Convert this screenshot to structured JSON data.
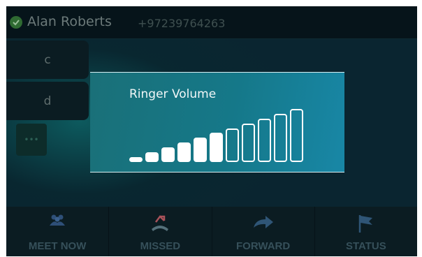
{
  "header": {
    "name": "Alan Roberts",
    "number": "+97239764263",
    "status_color": "#2f6a32"
  },
  "dialpad": {
    "keys": [
      "c",
      "d"
    ],
    "more_label": "•••"
  },
  "popup": {
    "title": "Ringer Volume",
    "level": 6,
    "max_level": 11
  },
  "softkeys": [
    {
      "label": "MEET NOW",
      "icon": "people-icon"
    },
    {
      "label": "MISSED",
      "icon": "missed-call-icon"
    },
    {
      "label": "FORWARD",
      "icon": "forward-arrow-icon"
    },
    {
      "label": "STATUS",
      "icon": "flag-icon"
    }
  ]
}
